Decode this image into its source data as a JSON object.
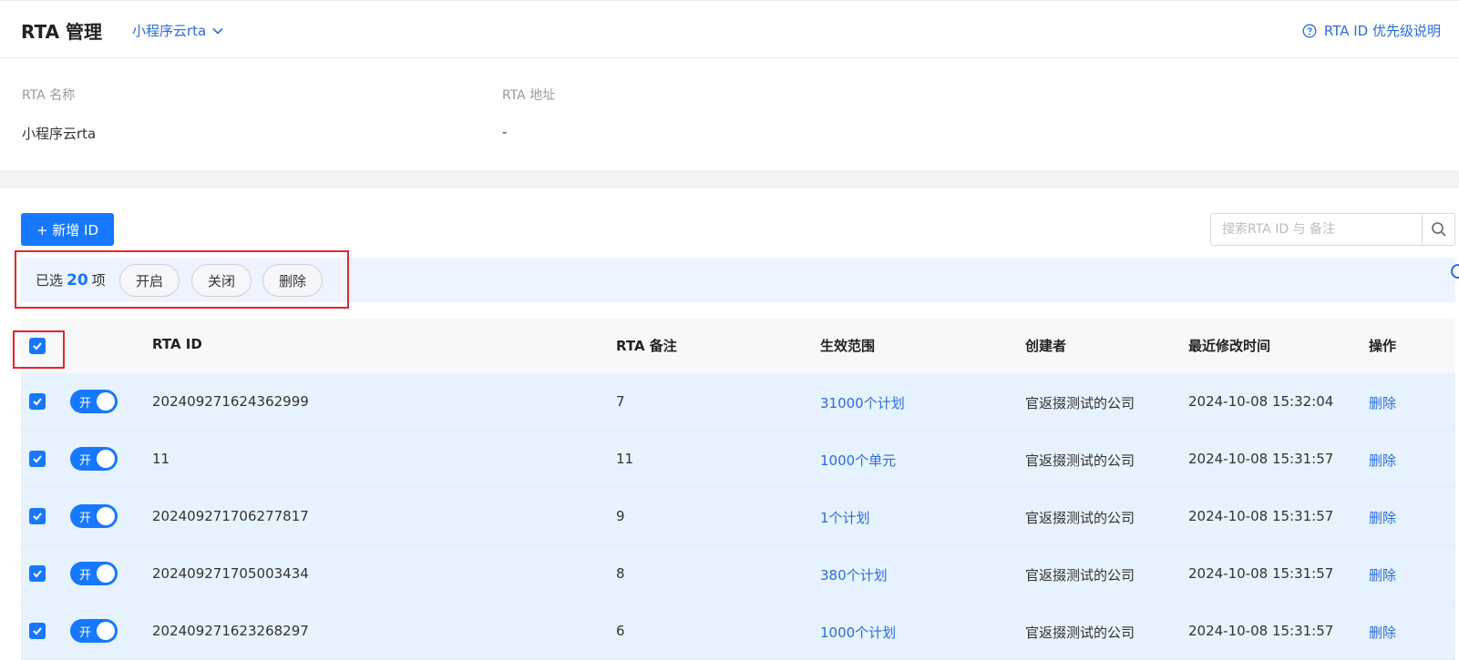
{
  "header": {
    "title": "RTA 管理",
    "rta_selector": "小程序云rta",
    "help_link": "RTA ID 优先级说明"
  },
  "info": {
    "name_label": "RTA 名称",
    "name_value": "小程序云rta",
    "address_label": "RTA 地址",
    "address_value": "-"
  },
  "toolbar": {
    "add_button": "+ 新增 ID",
    "search_placeholder": "搜索RTA ID 与 备注"
  },
  "selection": {
    "prefix": "已选",
    "count": "20",
    "suffix": "项",
    "enable_button": "开启",
    "disable_button": "关闭",
    "delete_button": "删除"
  },
  "table": {
    "headers": {
      "rta_id": "RTA ID",
      "note": "RTA 备注",
      "scope": "生效范围",
      "creator": "创建者",
      "modified": "最近修改时间",
      "actions": "操作"
    },
    "rows": [
      {
        "switch_label": "开",
        "rta_id": "202409271624362999",
        "note": "7",
        "scope": "31000个计划",
        "creator": "官返掇测试的公司",
        "modified": "2024-10-08 15:32:04",
        "action": "删除"
      },
      {
        "switch_label": "开",
        "rta_id": "11",
        "note": "11",
        "scope": "1000个单元",
        "creator": "官返掇测试的公司",
        "modified": "2024-10-08 15:31:57",
        "action": "删除"
      },
      {
        "switch_label": "开",
        "rta_id": "202409271706277817",
        "note": "9",
        "scope": "1个计划",
        "creator": "官返掇测试的公司",
        "modified": "2024-10-08 15:31:57",
        "action": "删除"
      },
      {
        "switch_label": "开",
        "rta_id": "202409271705003434",
        "note": "8",
        "scope": "380个计划",
        "creator": "官返掇测试的公司",
        "modified": "2024-10-08 15:31:57",
        "action": "删除"
      },
      {
        "switch_label": "开",
        "rta_id": "202409271623268297",
        "note": "6",
        "scope": "1000个计划",
        "creator": "官返掇测试的公司",
        "modified": "2024-10-08 15:31:57",
        "action": "删除"
      }
    ]
  },
  "colors": {
    "accent": "#1677ff",
    "link": "#2b6be0",
    "highlight_border": "#e5252a",
    "selected_row": "#e6f2fd"
  },
  "icons": {
    "selector_arrow": "chevron-down-icon",
    "help": "question-circle-icon",
    "search": "search-icon",
    "checkbox": "checkmark-icon"
  }
}
